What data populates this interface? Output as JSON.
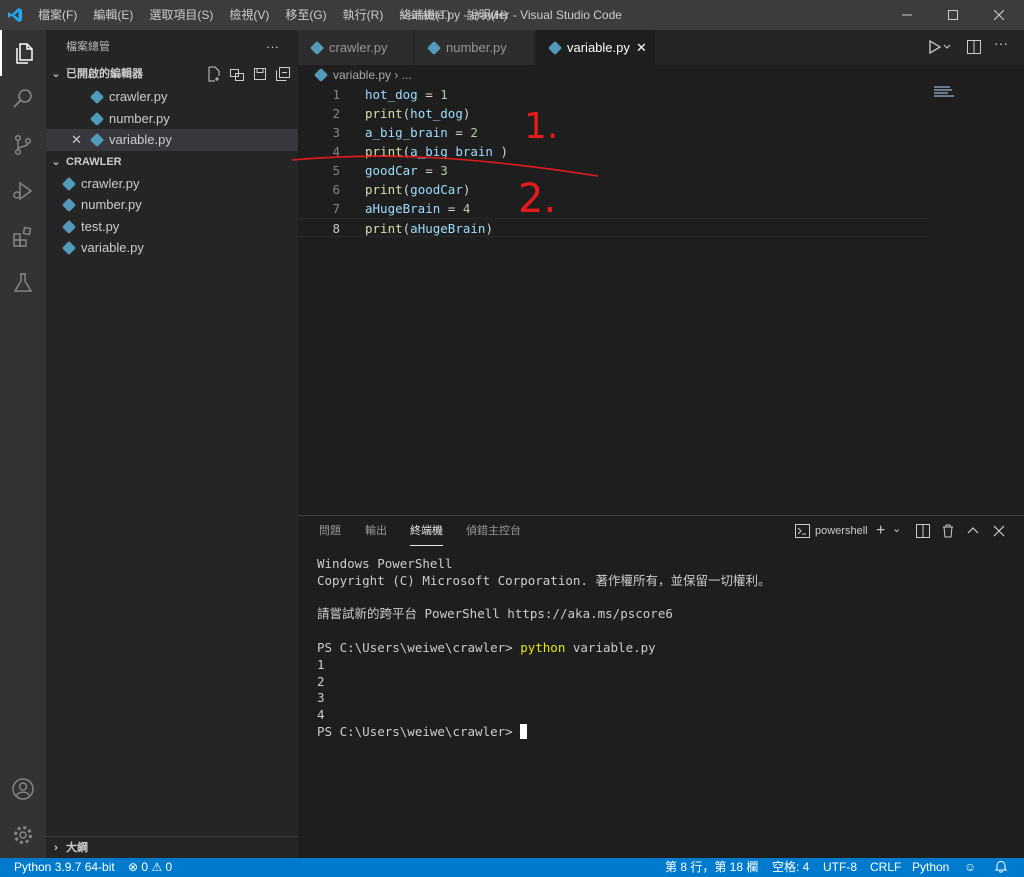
{
  "window": {
    "title": "variable.py - crawler - Visual Studio Code",
    "menus": [
      "檔案(F)",
      "編輯(E)",
      "選取項目(S)",
      "檢視(V)",
      "移至(G)",
      "執行(R)",
      "終端機(T)",
      "說明(H)"
    ]
  },
  "sidebar": {
    "title": "檔案總管",
    "more": "···",
    "open_editors": {
      "header": "已開啟的編輯器",
      "files": [
        "crawler.py",
        "number.py",
        "variable.py"
      ]
    },
    "folder": {
      "header": "CRAWLER",
      "files": [
        "crawler.py",
        "number.py",
        "test.py",
        "variable.py"
      ]
    },
    "outline": "大綱"
  },
  "editor": {
    "tabs": [
      "crawler.py",
      "number.py",
      "variable.py"
    ],
    "breadcrumb": {
      "file": "variable.py",
      "rest": "..."
    },
    "lines": [
      {
        "num": "1",
        "parts": [
          [
            "var",
            "hot_dog"
          ],
          [
            "op",
            " = "
          ],
          [
            "num",
            "1"
          ]
        ]
      },
      {
        "num": "2",
        "parts": [
          [
            "fn",
            "print"
          ],
          [
            "op",
            "("
          ],
          [
            "var",
            "hot_dog"
          ],
          [
            "op",
            ")"
          ]
        ]
      },
      {
        "num": "3",
        "parts": [
          [
            "var",
            "a_big_brain"
          ],
          [
            "op",
            " = "
          ],
          [
            "num",
            "2"
          ]
        ]
      },
      {
        "num": "4",
        "parts": [
          [
            "fn",
            "print"
          ],
          [
            "op",
            "("
          ],
          [
            "var",
            "a_big_brain"
          ],
          [
            "op",
            " )"
          ]
        ]
      },
      {
        "num": "5",
        "parts": [
          [
            "var",
            "goodCar"
          ],
          [
            "op",
            " = "
          ],
          [
            "num",
            "3"
          ]
        ]
      },
      {
        "num": "6",
        "parts": [
          [
            "fn",
            "print"
          ],
          [
            "op",
            "("
          ],
          [
            "var",
            "goodCar"
          ],
          [
            "op",
            ")"
          ]
        ]
      },
      {
        "num": "7",
        "parts": [
          [
            "var",
            "aHugeBrain"
          ],
          [
            "op",
            " = "
          ],
          [
            "num",
            "4"
          ]
        ]
      },
      {
        "num": "8",
        "parts": [
          [
            "fn",
            "print"
          ],
          [
            "op",
            "("
          ],
          [
            "var",
            "aHugeBrain"
          ],
          [
            "op",
            ")"
          ]
        ]
      }
    ]
  },
  "panel": {
    "tabs": [
      "問題",
      "輸出",
      "終端機",
      "偵錯主控台"
    ],
    "terminal_name": "powershell",
    "terminal": {
      "l1": "Windows PowerShell",
      "l2": "Copyright (C) Microsoft Corporation. 著作權所有，並保留一切權利。",
      "l3": "請嘗試新的跨平台 PowerShell https://aka.ms/pscore6",
      "prompt": "PS C:\\Users\\weiwe\\crawler> ",
      "cmd": "python",
      "arg": " variable.py",
      "out": [
        "1",
        "2",
        "3",
        "4"
      ]
    }
  },
  "statusbar": {
    "python": "Python 3.9.7 64-bit",
    "errors": "0",
    "warnings": "0",
    "position": "第 8 行，第 18 欄",
    "spaces": "空格: 4",
    "encoding": "UTF-8",
    "eol": "CRLF",
    "language": "Python"
  },
  "annotations": {
    "mark1": "1.",
    "mark2": "2."
  },
  "colors": {
    "accent": "#007acc",
    "annotation": "#e51a1a"
  }
}
